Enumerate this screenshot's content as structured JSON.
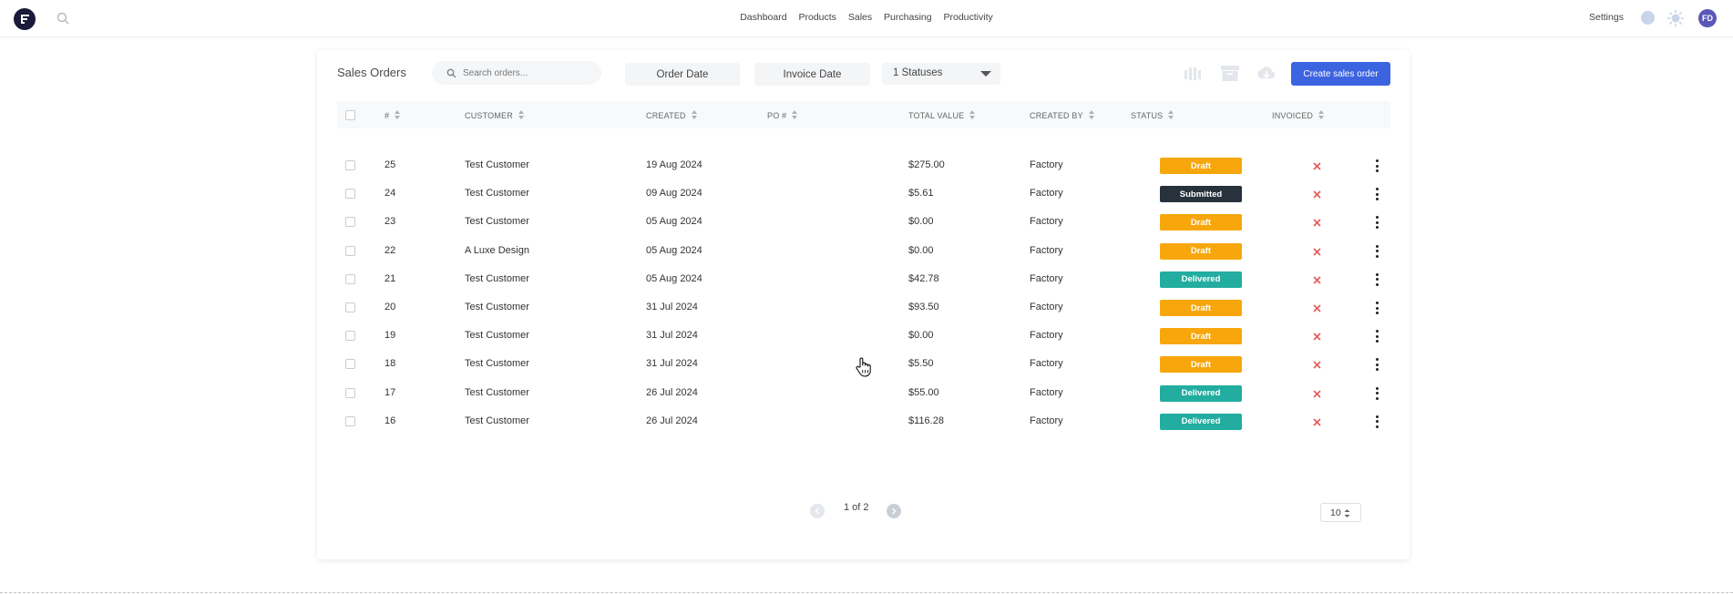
{
  "nav": {
    "items": [
      "Dashboard",
      "Products",
      "Sales",
      "Purchasing",
      "Productivity"
    ],
    "settings": "Settings",
    "avatar_initials": "FD"
  },
  "orders": {
    "title": "Sales Orders",
    "search_placeholder": "Search orders...",
    "order_date": "Order Date",
    "invoice_date": "Invoice Date",
    "statuses": "1 Statuses",
    "create_label": "Create sales order"
  },
  "columns": [
    "#",
    "CUSTOMER",
    "CREATED",
    "PO #",
    "TOTAL VALUE",
    "CREATED BY",
    "STATUS",
    "INVOICED"
  ],
  "rows": [
    {
      "num": "25",
      "customer": "Test Customer",
      "created": "19 Aug 2024",
      "po": "",
      "total": "$275.00",
      "created_by": "Factory",
      "status": "Draft"
    },
    {
      "num": "24",
      "customer": "Test Customer",
      "created": "09 Aug 2024",
      "po": "",
      "total": "$5.61",
      "created_by": "Factory",
      "status": "Submitted"
    },
    {
      "num": "23",
      "customer": "Test Customer",
      "created": "05 Aug 2024",
      "po": "",
      "total": "$0.00",
      "created_by": "Factory",
      "status": "Draft"
    },
    {
      "num": "22",
      "customer": "A Luxe Design",
      "created": "05 Aug 2024",
      "po": "",
      "total": "$0.00",
      "created_by": "Factory",
      "status": "Draft"
    },
    {
      "num": "21",
      "customer": "Test Customer",
      "created": "05 Aug 2024",
      "po": "",
      "total": "$42.78",
      "created_by": "Factory",
      "status": "Delivered"
    },
    {
      "num": "20",
      "customer": "Test Customer",
      "created": "31 Jul 2024",
      "po": "",
      "total": "$93.50",
      "created_by": "Factory",
      "status": "Draft"
    },
    {
      "num": "19",
      "customer": "Test Customer",
      "created": "31 Jul 2024",
      "po": "",
      "total": "$0.00",
      "created_by": "Factory",
      "status": "Draft"
    },
    {
      "num": "18",
      "customer": "Test Customer",
      "created": "31 Jul 2024",
      "po": "",
      "total": "$5.50",
      "created_by": "Factory",
      "status": "Draft"
    },
    {
      "num": "17",
      "customer": "Test Customer",
      "created": "26 Jul 2024",
      "po": "",
      "total": "$55.00",
      "created_by": "Factory",
      "status": "Delivered"
    },
    {
      "num": "16",
      "customer": "Test Customer",
      "created": "26 Jul 2024",
      "po": "",
      "total": "$116.28",
      "created_by": "Factory",
      "status": "Delivered"
    }
  ],
  "status_colors": {
    "Draft": "#f7a70c",
    "Submitted": "#27323d",
    "Delivered": "#22ada0"
  },
  "accent": "#3d64e0",
  "invoiced_icon": "x-icon",
  "pagination": {
    "text": "1 of 2",
    "page_size": "10"
  }
}
